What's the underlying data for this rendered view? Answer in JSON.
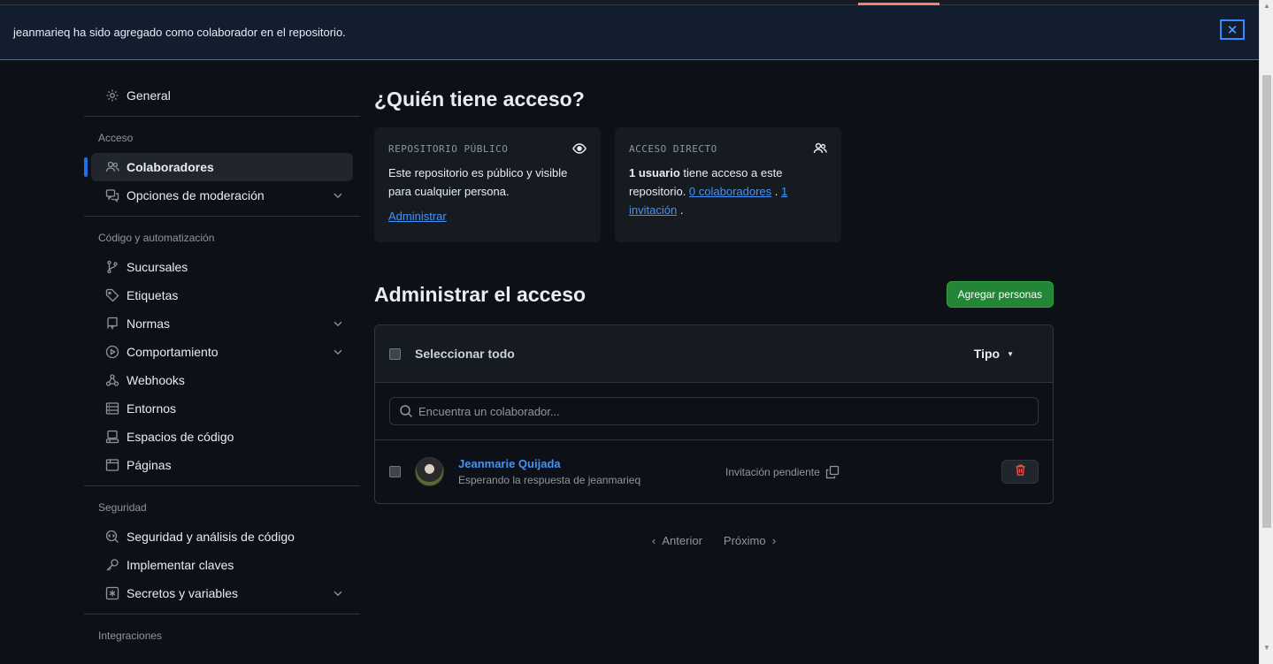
{
  "flash": {
    "message": "jeanmarieq ha sido agregado como colaborador en el repositorio.",
    "close_glyph": "✕"
  },
  "sidebar": {
    "general": "General",
    "sections": {
      "acceso": "Acceso",
      "codigo": "Código y automatización",
      "seguridad": "Seguridad",
      "integraciones": "Integraciones"
    },
    "items": {
      "colaboradores": "Colaboradores",
      "moderacion": "Opciones de moderación",
      "sucursales": "Sucursales",
      "etiquetas": "Etiquetas",
      "normas": "Normas",
      "comportamiento": "Comportamiento",
      "webhooks": "Webhooks",
      "entornos": "Entornos",
      "espacios": "Espacios de código",
      "paginas": "Páginas",
      "seguridad_analisis": "Seguridad y análisis de código",
      "claves": "Implementar claves",
      "secretos": "Secretos y variables"
    }
  },
  "main": {
    "title": "¿Quién tiene acceso?",
    "public_card": {
      "label": "REPOSITORIO PÚBLICO",
      "text": "Este repositorio es público y visible para cualquier persona.",
      "link": "Administrar"
    },
    "direct_card": {
      "label": "ACCESO DIRECTO",
      "strong": "1 usuario",
      "text_a": " tiene acceso a este repositorio. ",
      "link_collab": "0 colaboradores",
      "sep": " . ",
      "link_inv": "1 invitación",
      "end": " ."
    },
    "manage_title": "Administrar el acceso",
    "add_button": "Agregar personas",
    "select_all": "Seleccionar todo",
    "type_filter": "Tipo",
    "search_placeholder": "Encuentra un colaborador...",
    "collaborators": [
      {
        "name": "Jeanmarie Quijada",
        "status": "Esperando la respuesta de jeanmarieq",
        "role": "Invitación pendiente"
      }
    ],
    "pager": {
      "prev": "Anterior",
      "next": "Próximo"
    }
  },
  "colors": {
    "accent": "#1f6feb",
    "link": "#4493f8",
    "green": "#238636",
    "danger": "#f85149"
  }
}
